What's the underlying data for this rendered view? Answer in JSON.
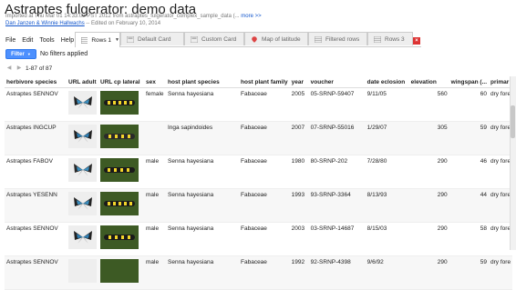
{
  "header": {
    "title": "Astraptes fulgerator: demo data",
    "imported": "Imported at Thu Mar 01 14:33:02 PST 2012 from astraptes_fulgerator_complex_sample_data (...",
    "more_link": "more >>",
    "authors": "Dan Janzen & Winnie Hallwachs",
    "edited": " -- Edited on February 10, 2014"
  },
  "menu": [
    "File",
    "Edit",
    "Tools",
    "Help"
  ],
  "tabs": [
    {
      "label": "Rows 1",
      "active": true,
      "icon": "rows-icon"
    },
    {
      "label": "Default Card",
      "active": false,
      "icon": "card-icon"
    },
    {
      "label": "Custom Card",
      "active": false,
      "icon": "card-icon"
    },
    {
      "label": "Map of latitude",
      "active": false,
      "icon": "map-pin-icon"
    },
    {
      "label": "Filtered rows",
      "active": false,
      "icon": "rows-icon"
    },
    {
      "label": "Rows 3",
      "active": false,
      "icon": "rows-icon"
    }
  ],
  "filter": {
    "button_label": "Filter",
    "status": "No filters applied"
  },
  "pager": {
    "range": "1-87 of 87"
  },
  "columns": [
    "herbivore species",
    "URL adult",
    "URL cp lateral",
    "sex",
    "host plant species",
    "host plant family",
    "year",
    "voucher",
    "date eclosion",
    "elevation",
    "wingspan (...",
    "primar"
  ],
  "rows": [
    {
      "species": "Astraptes SENNOV",
      "sex": "female",
      "host": "Senna hayesiana",
      "family": "Fabaceae",
      "year": "2005",
      "voucher": "05-SRNP-59407",
      "date": "9/11/05",
      "elevation": "560",
      "wingspan": "60",
      "primary": "dry fore"
    },
    {
      "species": "Astraptes INGCUP",
      "sex": "",
      "host": "Inga sapindoides",
      "family": "Fabaceae",
      "year": "2007",
      "voucher": "07-SRNP-55016",
      "date": "1/29/07",
      "elevation": "305",
      "wingspan": "59",
      "primary": "dry fore"
    },
    {
      "species": "Astraptes FABOV",
      "sex": "male",
      "host": "Senna hayesiana",
      "family": "Fabaceae",
      "year": "1980",
      "voucher": "80-SRNP-202",
      "date": "7/28/80",
      "elevation": "290",
      "wingspan": "46",
      "primary": "dry fore"
    },
    {
      "species": "Astraptes YESENN",
      "sex": "male",
      "host": "Senna hayesiana",
      "family": "Fabaceae",
      "year": "1993",
      "voucher": "93-SRNP-3364",
      "date": "8/13/93",
      "elevation": "290",
      "wingspan": "44",
      "primary": "dry fore"
    },
    {
      "species": "Astraptes SENNOV",
      "sex": "male",
      "host": "Senna hayesiana",
      "family": "Fabaceae",
      "year": "2003",
      "voucher": "03-SRNP-14687",
      "date": "8/15/03",
      "elevation": "290",
      "wingspan": "58",
      "primary": "dry fore"
    },
    {
      "species": "Astraptes SENNOV",
      "sex": "male",
      "host": "Senna hayesiana",
      "family": "Fabaceae",
      "year": "1992",
      "voucher": "92-SRNP-4398",
      "date": "9/6/92",
      "elevation": "290",
      "wingspan": "59",
      "primary": "dry fore"
    }
  ]
}
